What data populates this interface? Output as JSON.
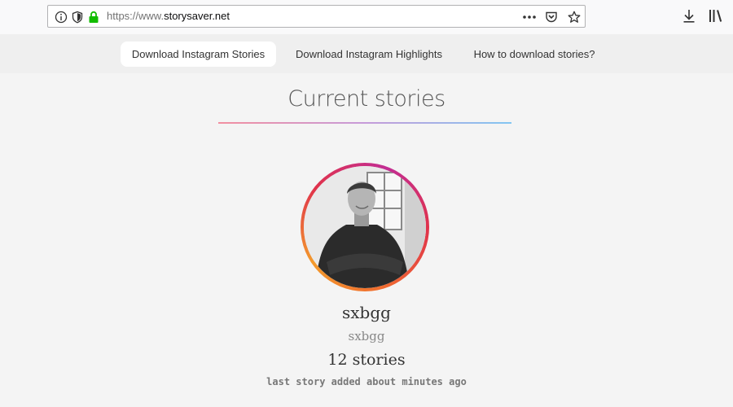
{
  "browser": {
    "url_scheme": "https://www.",
    "url_host": "storysaver.net",
    "icons": [
      "info-icon",
      "tracking-shield-icon",
      "lock-icon",
      "more-icon",
      "pocket-icon",
      "bookmark-star-icon",
      "download-icon",
      "library-icon"
    ]
  },
  "nav": {
    "tabs": [
      {
        "label": "Download Instagram Stories",
        "active": true
      },
      {
        "label": "Download Instagram Highlights",
        "active": false
      },
      {
        "label": "How to download stories?",
        "active": false
      }
    ]
  },
  "main": {
    "heading": "Current stories",
    "profile": {
      "username": "sxbgg",
      "subname": "sxbgg",
      "stories_count": "12 stories",
      "last_added": "last story added about minutes ago"
    }
  },
  "colors": {
    "heading_gradient": [
      "#f28fa0",
      "#c69bd9",
      "#82c6f2"
    ],
    "ring_gradient": [
      "#c22d93",
      "#e0334b",
      "#f39a2c"
    ],
    "lock_green": "#12bc00"
  }
}
